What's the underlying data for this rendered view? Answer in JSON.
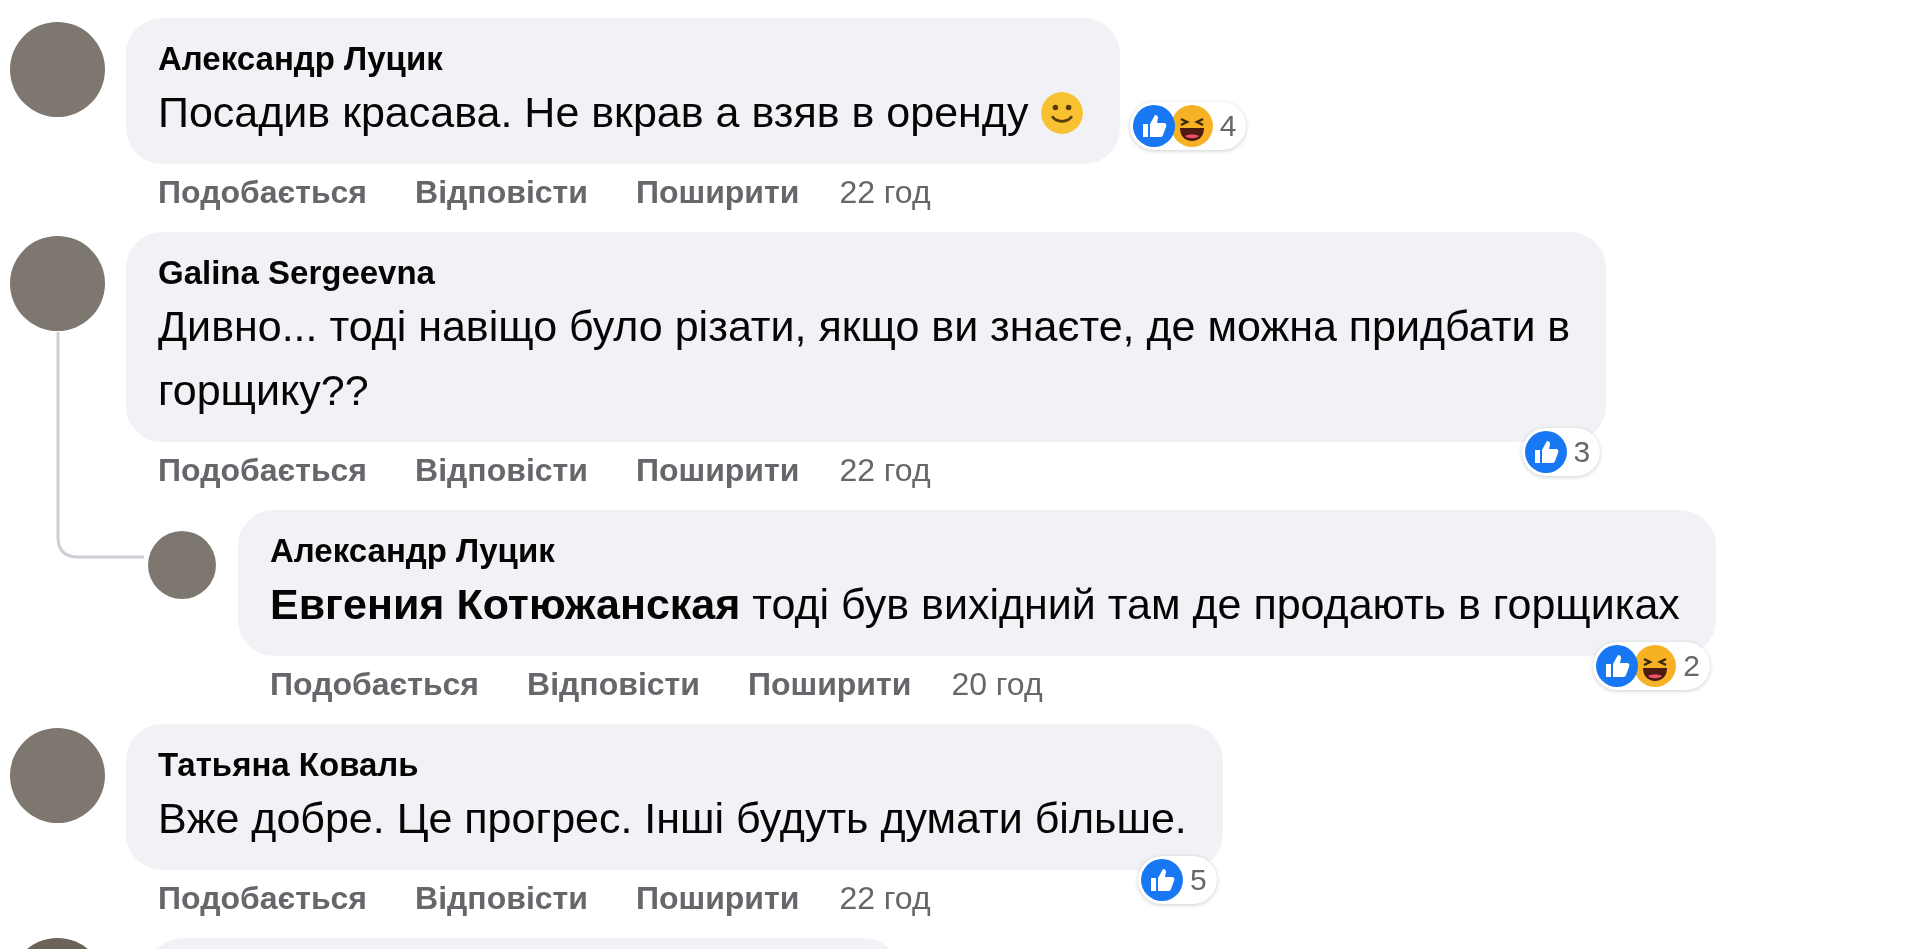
{
  "comments": [
    {
      "kind": "comment",
      "reply": false,
      "name": "Александр Луцик",
      "lines": [
        "Посадив красава. Не вкрав а взяв в оренду"
      ],
      "smiley": true,
      "reactions": {
        "beside_text": true,
        "like": true,
        "haha": true,
        "count": "4"
      },
      "actions": [
        "Подобається",
        "Відповісти",
        "Поширити"
      ],
      "time": "22 год",
      "thread": false
    },
    {
      "kind": "comment",
      "reply": false,
      "name": "Galina Sergeevna",
      "lines": [
        "Дивно... тоді навіщо було різати, якщо ви знаєте, де можна придбати в",
        "горщику??"
      ],
      "smiley": false,
      "reactions": {
        "beside_text": false,
        "like": true,
        "haha": false,
        "count": "3"
      },
      "actions": [
        "Подобається",
        "Відповісти",
        "Поширити"
      ],
      "time": "22 год",
      "thread": true
    },
    {
      "kind": "comment",
      "reply": true,
      "name": "Александр Луцик",
      "lines": [
        "**Евгения Котюжанская** тоді був вихідний там де продають в горщиках"
      ],
      "smiley": false,
      "reactions": {
        "beside_text": false,
        "like": true,
        "haha": true,
        "count": "2"
      },
      "actions": [
        "Подобається",
        "Відповісти",
        "Поширити"
      ],
      "time": "20 год",
      "thread": false
    },
    {
      "kind": "comment",
      "reply": false,
      "name": "Татьяна Коваль",
      "lines": [
        "Вже добре. Це прогрес. Інші будуть думати більше."
      ],
      "smiley": false,
      "reactions": {
        "beside_text": false,
        "like": true,
        "haha": false,
        "count": "5"
      },
      "actions": [
        "Подобається",
        "Відповісти",
        "Поширити"
      ],
      "time": "22 год",
      "thread": false
    },
    {
      "kind": "cut_off"
    }
  ]
}
